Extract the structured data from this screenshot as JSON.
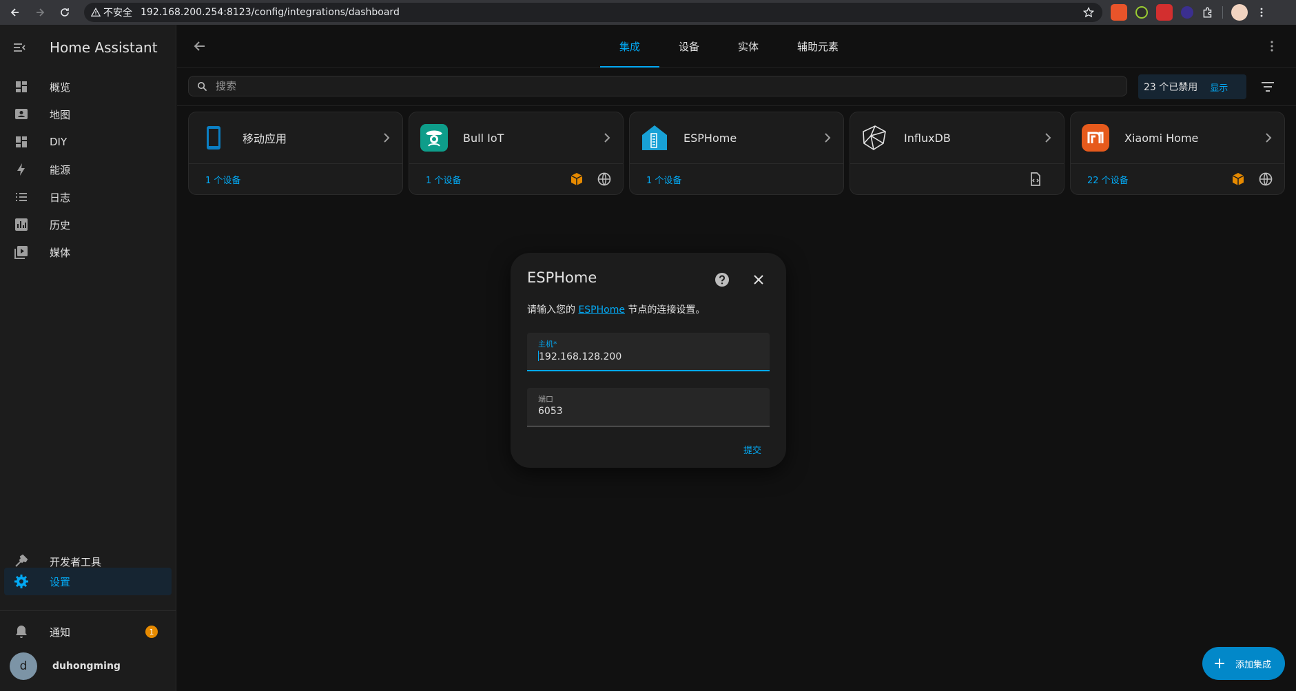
{
  "browser": {
    "insecure_label": "不安全",
    "url": "192.168.200.254:8123/config/integrations/dashboard"
  },
  "sidebar": {
    "title": "Home Assistant",
    "items": [
      {
        "label": "概览",
        "icon": "dashboard-icon"
      },
      {
        "label": "地图",
        "icon": "map-icon"
      },
      {
        "label": "DIY",
        "icon": "dashboard-icon"
      },
      {
        "label": "能源",
        "icon": "lightning-icon"
      },
      {
        "label": "日志",
        "icon": "list-icon"
      },
      {
        "label": "历史",
        "icon": "chart-icon"
      },
      {
        "label": "媒体",
        "icon": "media-icon"
      }
    ],
    "developer_tools": "开发者工具",
    "settings": "设置",
    "notifications": "通知",
    "notification_count": "1",
    "user_initial": "d",
    "user_name": "duhongming"
  },
  "topbar": {
    "tabs": [
      "集成",
      "设备",
      "实体",
      "辅助元素"
    ],
    "active_tab": "集成"
  },
  "search": {
    "placeholder": "搜索",
    "disabled_count": "23 个已禁用",
    "show_label": "显示"
  },
  "integrations": [
    {
      "name": "移动应用",
      "devices": "1 个设备"
    },
    {
      "name": "Bull IoT",
      "devices": "1 个设备"
    },
    {
      "name": "ESPHome",
      "devices": "1 个设备"
    },
    {
      "name": "InfluxDB",
      "devices": ""
    },
    {
      "name": "Xiaomi Home",
      "devices": "22 个设备"
    }
  ],
  "dialog": {
    "title": "ESPHome",
    "desc_before": "请输入您的 ",
    "desc_link": "ESPHome",
    "desc_after": " 节点的连接设置。",
    "host_label": "主机*",
    "host_value": "192.168.128.200",
    "port_label": "端口",
    "port_value": "6053",
    "submit": "提交"
  },
  "fab": {
    "label": "添加集成"
  },
  "colors": {
    "accent": "#03a9f4",
    "warning": "#e68a00",
    "background": "#111111",
    "card": "#1c1c1c"
  }
}
